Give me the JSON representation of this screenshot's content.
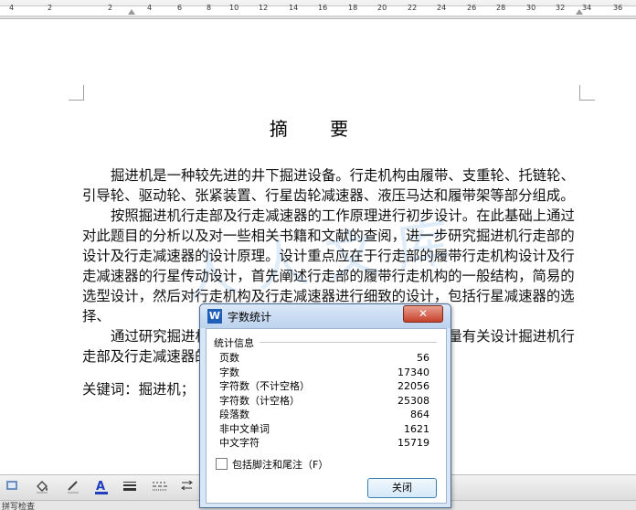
{
  "ruler": {
    "ticks": [
      "4",
      "2",
      "2",
      "4",
      "6",
      "8",
      "10",
      "12",
      "14",
      "16",
      "18",
      "20",
      "22",
      "24",
      "26",
      "28",
      "30",
      "32",
      "34",
      "36"
    ]
  },
  "document": {
    "title": "摘 要",
    "paragraphs": [
      "掘进机是一种较先进的井下掘进设备。行走机构由履带、支重轮、托链轮、引导轮、驱动轮、张紧装置、行星齿轮减速器、液压马达和履带架等部分组成。",
      "按照掘进机行走部及行走减速器的工作原理进行初步设计。在此基础上通过对此题目的分析以及对一些相关书籍和文献的查阅，进一步研究掘进机行走部的设计及行走减速器的设计原理。设计重点应在于行走部的履带行走机构设计及行走减速器的行星传动设计，首先阐述行走部的履带行走机构的一般结构，简易的选型设计，然后对行走机构及行走减速器进行细致的设计，包括行星减速器的选择、",
      "通过研究掘进机行走部及行走减速器的设计，获得了大量有关设计掘进机行走部及行走减速器的知识。"
    ],
    "keywords_label": "关键词：掘进机；",
    "watermark": "人人文库"
  },
  "dialog": {
    "title": "字数统计",
    "close_symbol": "✕",
    "app_icon_letter": "W",
    "group_label": "统计信息",
    "stats": [
      {
        "label": "页数",
        "value": "56"
      },
      {
        "label": "字数",
        "value": "17340"
      },
      {
        "label": "字符数（不计空格）",
        "value": "22056"
      },
      {
        "label": "字符数（计空格）",
        "value": "25308"
      },
      {
        "label": "段落数",
        "value": "864"
      },
      {
        "label": "非中文单词",
        "value": "1621"
      },
      {
        "label": "中文字符",
        "value": "15719"
      }
    ],
    "checkbox_label": "包括脚注和尾注（F）",
    "checkbox_checked": false,
    "close_button": "关闭"
  },
  "toolbar": {
    "buttons": [
      "fill-color-icon",
      "line-color-icon",
      "font-color-icon",
      "line-style-icon",
      "dash-style-icon",
      "arrow-style-icon"
    ],
    "font_color": "#1f3fbf"
  },
  "statusbar": {
    "text": "拼写检查"
  }
}
